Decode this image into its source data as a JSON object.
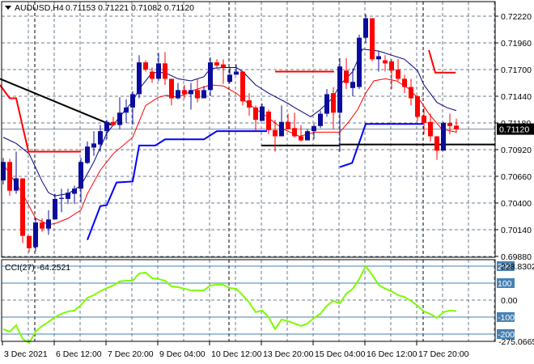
{
  "header": {
    "symbol_label": "AUDUSD,H4",
    "ohlc_label": "0.71153 0.71221 0.71082 0.71120",
    "menu_icon": "triangle-down-icon"
  },
  "current_price_label": "0.71120",
  "colors": {
    "bull": "#0c0c9c",
    "bear": "#ff0000",
    "ma_fast": "#000080",
    "ma_slow": "#ff0000",
    "support_step": "#0000ff",
    "resistance_step": "#ff0000",
    "trendline": "#000000",
    "cci": "#7cfc00",
    "cci_levels": "#4682b4",
    "grid": "#6e7b8b"
  },
  "chart_data": [
    {
      "type": "candlestick",
      "title": "AUDUSD,H4",
      "ylim": [
        0.6988,
        0.7222
      ],
      "y_ticks": [
        "0.72220",
        "0.71960",
        "0.71700",
        "0.71440",
        "0.71180",
        "0.70920",
        "0.70660",
        "0.70400",
        "0.70140",
        "0.69880"
      ],
      "x_labels": [
        {
          "i": 0,
          "text": "3 Dec 2021"
        },
        {
          "i": 8,
          "text": "6 Dec 12:00"
        },
        {
          "i": 16,
          "text": "7 Dec 20:00"
        },
        {
          "i": 24,
          "text": "9 Dec 04:00"
        },
        {
          "i": 32,
          "text": "10 Dec 12:00"
        },
        {
          "i": 40,
          "text": "13 Dec 20:00"
        },
        {
          "i": 48,
          "text": "15 Dec 04:00"
        },
        {
          "i": 56,
          "text": "16 Dec 12:00"
        },
        {
          "i": 64,
          "text": "17 Dec 20:00"
        }
      ],
      "ohlc": [
        [
          0.7062,
          0.7084,
          0.7058,
          0.708
        ],
        [
          0.708,
          0.7083,
          0.7047,
          0.7052
        ],
        [
          0.7052,
          0.709,
          0.7049,
          0.7064
        ],
        [
          0.7064,
          0.7064,
          0.7001,
          0.7008
        ],
        [
          0.7008,
          0.7008,
          0.6992,
          0.6996
        ],
        [
          0.6997,
          0.7025,
          0.6993,
          0.7021
        ],
        [
          0.7021,
          0.7025,
          0.7012,
          0.7015
        ],
        [
          0.7015,
          0.7033,
          0.7009,
          0.7024
        ],
        [
          0.7024,
          0.7049,
          0.7024,
          0.7044
        ],
        [
          0.7044,
          0.7054,
          0.7031,
          0.7045
        ],
        [
          0.7044,
          0.7054,
          0.7039,
          0.705
        ],
        [
          0.7049,
          0.7057,
          0.7039,
          0.7054
        ],
        [
          0.7054,
          0.7084,
          0.7041,
          0.708
        ],
        [
          0.7079,
          0.71,
          0.7078,
          0.7095
        ],
        [
          0.7094,
          0.711,
          0.7086,
          0.7098
        ],
        [
          0.7097,
          0.7116,
          0.709,
          0.711
        ],
        [
          0.711,
          0.7121,
          0.7102,
          0.7119
        ],
        [
          0.7119,
          0.7124,
          0.7115,
          0.7116
        ],
        [
          0.7116,
          0.7143,
          0.7112,
          0.7128
        ],
        [
          0.7128,
          0.7141,
          0.7118,
          0.7133
        ],
        [
          0.7133,
          0.7149,
          0.7116,
          0.7146
        ],
        [
          0.7146,
          0.7184,
          0.7142,
          0.7177
        ],
        [
          0.7177,
          0.7179,
          0.7168,
          0.717
        ],
        [
          0.7168,
          0.7172,
          0.7157,
          0.7161
        ],
        [
          0.7161,
          0.7186,
          0.7159,
          0.7176
        ],
        [
          0.7176,
          0.7187,
          0.7155,
          0.7161
        ],
        [
          0.7161,
          0.7161,
          0.7135,
          0.7142
        ],
        [
          0.7142,
          0.7157,
          0.7141,
          0.715
        ],
        [
          0.715,
          0.7155,
          0.7142,
          0.7146
        ],
        [
          0.7146,
          0.7157,
          0.7131,
          0.715
        ],
        [
          0.715,
          0.7161,
          0.7138,
          0.7142
        ],
        [
          0.7142,
          0.7154,
          0.7142,
          0.715
        ],
        [
          0.715,
          0.7182,
          0.7144,
          0.7177
        ],
        [
          0.7177,
          0.718,
          0.7172,
          0.7174
        ],
        [
          0.7175,
          0.718,
          0.7156,
          0.7172
        ],
        [
          0.7158,
          0.7172,
          0.7157,
          0.7165
        ],
        [
          0.7165,
          0.7175,
          0.7165,
          0.7168
        ],
        [
          0.7168,
          0.7168,
          0.7135,
          0.7139
        ],
        [
          0.714,
          0.7147,
          0.7125,
          0.7133
        ],
        [
          0.7133,
          0.7135,
          0.711,
          0.7121
        ],
        [
          0.712,
          0.7137,
          0.712,
          0.7134
        ],
        [
          0.7129,
          0.7131,
          0.7107,
          0.7111
        ],
        [
          0.7111,
          0.7121,
          0.709,
          0.7105
        ],
        [
          0.7105,
          0.7135,
          0.7105,
          0.7119
        ],
        [
          0.7119,
          0.7127,
          0.7112,
          0.7112
        ],
        [
          0.7113,
          0.7128,
          0.7104,
          0.7105
        ],
        [
          0.7105,
          0.7116,
          0.71,
          0.7101
        ],
        [
          0.7101,
          0.7112,
          0.7101,
          0.711
        ],
        [
          0.711,
          0.7117,
          0.7102,
          0.7115
        ],
        [
          0.7115,
          0.713,
          0.7113,
          0.7127
        ],
        [
          0.7127,
          0.7151,
          0.7124,
          0.7146
        ],
        [
          0.7147,
          0.7153,
          0.7112,
          0.7128
        ],
        [
          0.7128,
          0.7181,
          0.709,
          0.7173
        ],
        [
          0.7169,
          0.7181,
          0.7151,
          0.7157
        ],
        [
          0.7152,
          0.7171,
          0.7144,
          0.7158
        ],
        [
          0.7153,
          0.7204,
          0.7151,
          0.7201
        ],
        [
          0.7201,
          0.7224,
          0.7196,
          0.722
        ],
        [
          0.722,
          0.722,
          0.7178,
          0.718
        ],
        [
          0.718,
          0.7188,
          0.7168,
          0.7183
        ],
        [
          0.7179,
          0.7184,
          0.7168,
          0.7176
        ],
        [
          0.7178,
          0.718,
          0.7151,
          0.7169
        ],
        [
          0.717,
          0.718,
          0.7159,
          0.7161
        ],
        [
          0.7161,
          0.7165,
          0.7147,
          0.7153
        ],
        [
          0.7153,
          0.7161,
          0.7135,
          0.7142
        ],
        [
          0.7144,
          0.7145,
          0.712,
          0.7124
        ],
        [
          0.7125,
          0.7133,
          0.7107,
          0.7118
        ],
        [
          0.7119,
          0.7127,
          0.71,
          0.7105
        ],
        [
          0.7105,
          0.7105,
          0.7082,
          0.7091
        ],
        [
          0.7091,
          0.7119,
          0.7091,
          0.7118
        ],
        [
          0.7118,
          0.7127,
          0.7107,
          0.7115
        ],
        [
          0.71153,
          0.71221,
          0.71082,
          0.7112
        ]
      ],
      "ma_fast": [
        [
          0,
          0.7104
        ],
        [
          2,
          0.7098
        ],
        [
          4,
          0.7088
        ],
        [
          6,
          0.7061
        ],
        [
          7,
          0.705
        ],
        [
          8,
          0.7047
        ],
        [
          10,
          0.7049
        ],
        [
          12,
          0.7057
        ],
        [
          14,
          0.708
        ],
        [
          16,
          0.7108
        ],
        [
          18,
          0.7124
        ],
        [
          20,
          0.7139
        ],
        [
          21,
          0.7151
        ],
        [
          23,
          0.7167
        ],
        [
          25,
          0.7167
        ],
        [
          27,
          0.7161
        ],
        [
          29,
          0.7159
        ],
        [
          31,
          0.7163
        ],
        [
          32,
          0.7171
        ],
        [
          34,
          0.7172
        ],
        [
          36,
          0.7172
        ],
        [
          37,
          0.7168
        ],
        [
          39,
          0.7155
        ],
        [
          41,
          0.7147
        ],
        [
          44,
          0.7137
        ],
        [
          45,
          0.7133
        ],
        [
          47.5,
          0.7124
        ],
        [
          49,
          0.7131
        ],
        [
          51,
          0.7143
        ],
        [
          52,
          0.7155
        ],
        [
          54,
          0.7168
        ],
        [
          55.5,
          0.719
        ],
        [
          58,
          0.7188
        ],
        [
          62,
          0.718
        ],
        [
          64,
          0.7169
        ],
        [
          65,
          0.7155
        ],
        [
          67,
          0.7138
        ],
        [
          68.5,
          0.7133
        ],
        [
          70,
          0.713
        ]
      ],
      "ma_slow": [
        [
          0,
          0.7078
        ],
        [
          3,
          0.7049
        ],
        [
          5,
          0.7025
        ],
        [
          7,
          0.7019
        ],
        [
          8,
          0.702
        ],
        [
          10,
          0.7025
        ],
        [
          12,
          0.7033
        ],
        [
          13,
          0.7049
        ],
        [
          15,
          0.7072
        ],
        [
          17,
          0.7088
        ],
        [
          20,
          0.7104
        ],
        [
          22,
          0.7135
        ],
        [
          24,
          0.7143
        ],
        [
          25.25,
          0.7145
        ],
        [
          27,
          0.7143
        ],
        [
          29.5,
          0.715
        ],
        [
          32,
          0.7155
        ],
        [
          34,
          0.7154
        ],
        [
          36,
          0.7147
        ],
        [
          38.25,
          0.7135
        ],
        [
          40.75,
          0.7124
        ],
        [
          43.25,
          0.7112
        ],
        [
          45.75,
          0.7105
        ],
        [
          48.25,
          0.7109
        ],
        [
          52,
          0.7109
        ],
        [
          53.5,
          0.712
        ],
        [
          54.75,
          0.7131
        ],
        [
          56,
          0.7147
        ],
        [
          57.25,
          0.7159
        ],
        [
          59,
          0.7161
        ],
        [
          60.75,
          0.7159
        ],
        [
          62.75,
          0.7151
        ],
        [
          64.5,
          0.7139
        ],
        [
          65.75,
          0.7127
        ],
        [
          67.75,
          0.7112
        ],
        [
          70,
          0.7109
        ]
      ],
      "support_step": [
        [
          [
            13,
            0.7004
          ],
          [
            15,
            0.7037
          ],
          [
            16,
            0.7038
          ],
          [
            17.5,
            0.706
          ],
          [
            20,
            0.7061
          ],
          [
            21,
            0.7096
          ],
          [
            23.5,
            0.7096
          ],
          [
            25,
            0.7102
          ],
          [
            31,
            0.7102
          ],
          [
            33,
            0.711
          ],
          [
            40.75,
            0.711
          ]
        ],
        [
          [
            52,
            0.7075
          ],
          [
            53.9,
            0.7079
          ],
          [
            56,
            0.7117
          ],
          [
            64.9,
            0.7117
          ]
        ]
      ],
      "resistance_step": [
        [
          [
            -0.5,
            0.7155
          ],
          [
            1,
            0.7142
          ],
          [
            2,
            0.7142
          ],
          [
            3.9,
            0.709
          ],
          [
            12,
            0.709
          ]
        ],
        [
          [
            42,
            0.7168
          ],
          [
            51.1,
            0.7168
          ]
        ],
        [
          [
            65.75,
            0.7189
          ],
          [
            66.75,
            0.7167
          ],
          [
            69.9,
            0.7167
          ]
        ]
      ],
      "trendlines": [
        [
          [
            -0.5,
            0.7161
          ],
          [
            16.75,
            0.7116
          ]
        ],
        [
          [
            39.9,
            0.7096
          ],
          [
            52,
            0.7096
          ]
        ],
        [
          [
            52,
            0.7097
          ],
          [
            76,
            0.7097
          ]
        ]
      ],
      "current_price": 0.7112
    },
    {
      "type": "line",
      "title": "CCI(27) -64.2521",
      "ylim": [
        -275.0665,
        228.8302
      ],
      "scale_max_label": "228.8302",
      "scale_min_label": "-275.0665",
      "levels": [
        {
          "v": 200,
          "text": "200"
        },
        {
          "v": 100,
          "text": "100"
        },
        {
          "v": -100,
          "text": "-100"
        },
        {
          "v": -200,
          "text": "-200"
        }
      ],
      "zero_label": "0.00",
      "values": [
        -171,
        -186,
        -148,
        -229,
        -252,
        -186,
        -152,
        -129,
        -100,
        -81,
        -67,
        -62,
        -29,
        14,
        29,
        52,
        71,
        86,
        110,
        114,
        114,
        157,
        162,
        129,
        124,
        114,
        81,
        76,
        67,
        57,
        57,
        57,
        86,
        90,
        90,
        71,
        67,
        29,
        -14,
        -71,
        -62,
        -100,
        -171,
        -114,
        -124,
        -138,
        -152,
        -138,
        -105,
        -81,
        -33,
        -5,
        -19,
        38,
        67,
        124,
        200,
        148,
        90,
        67,
        52,
        29,
        19,
        -5,
        -33,
        -67,
        -81,
        -105,
        -71,
        -62,
        -64.2521
      ]
    }
  ]
}
